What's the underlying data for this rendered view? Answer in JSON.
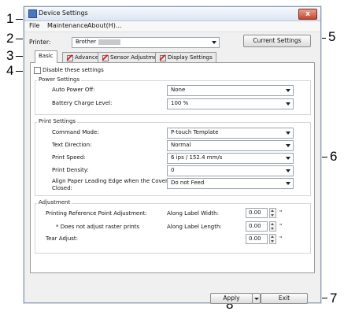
{
  "callouts": [
    "1",
    "2",
    "3",
    "4",
    "5",
    "6",
    "7",
    "8"
  ],
  "window": {
    "title": "Device Settings",
    "close_glyph": "x"
  },
  "menu": {
    "file": "File",
    "maintenance": "Maintenance",
    "about": "About(H)..."
  },
  "printer": {
    "label": "Printer:",
    "value": "Brother"
  },
  "current_settings_button": "Current Settings",
  "tabs": [
    "Basic",
    "Advanced",
    "Sensor Adjustment",
    "Display Settings"
  ],
  "disable_settings": {
    "label": "Disable these settings",
    "checked": false
  },
  "power": {
    "title": "Power Settings",
    "auto_power_off_label": "Auto Power Off:",
    "auto_power_off_value": "None",
    "battery_label": "Battery Charge Level:",
    "battery_value": "100 %"
  },
  "print": {
    "title": "Print Settings",
    "command_mode_label": "Command Mode:",
    "command_mode_value": "P-touch Template",
    "text_direction_label": "Text Direction:",
    "text_direction_value": "Normal",
    "print_speed_label": "Print Speed:",
    "print_speed_value": "6 ips / 152.4 mm/s",
    "print_density_label": "Print Density:",
    "print_density_value": "0",
    "align_label_line1": "Align Paper Leading Edge when the Cover is",
    "align_label_line2": "Closed:",
    "align_value": "Do not Feed"
  },
  "adjustment": {
    "title": "Adjustment",
    "ref_point_label": "Printing Reference Point Adjustment:",
    "raster_note": "* Does not adjust raster prints",
    "tear_label": "Tear Adjust:",
    "along_width_label": "Along Label Width:",
    "along_length_label": "Along Label Length:",
    "width_value": "0.00",
    "length_value": "0.00",
    "tear_value": "0.00",
    "unit": "\""
  },
  "footer": {
    "apply": "Apply",
    "exit": "Exit"
  }
}
